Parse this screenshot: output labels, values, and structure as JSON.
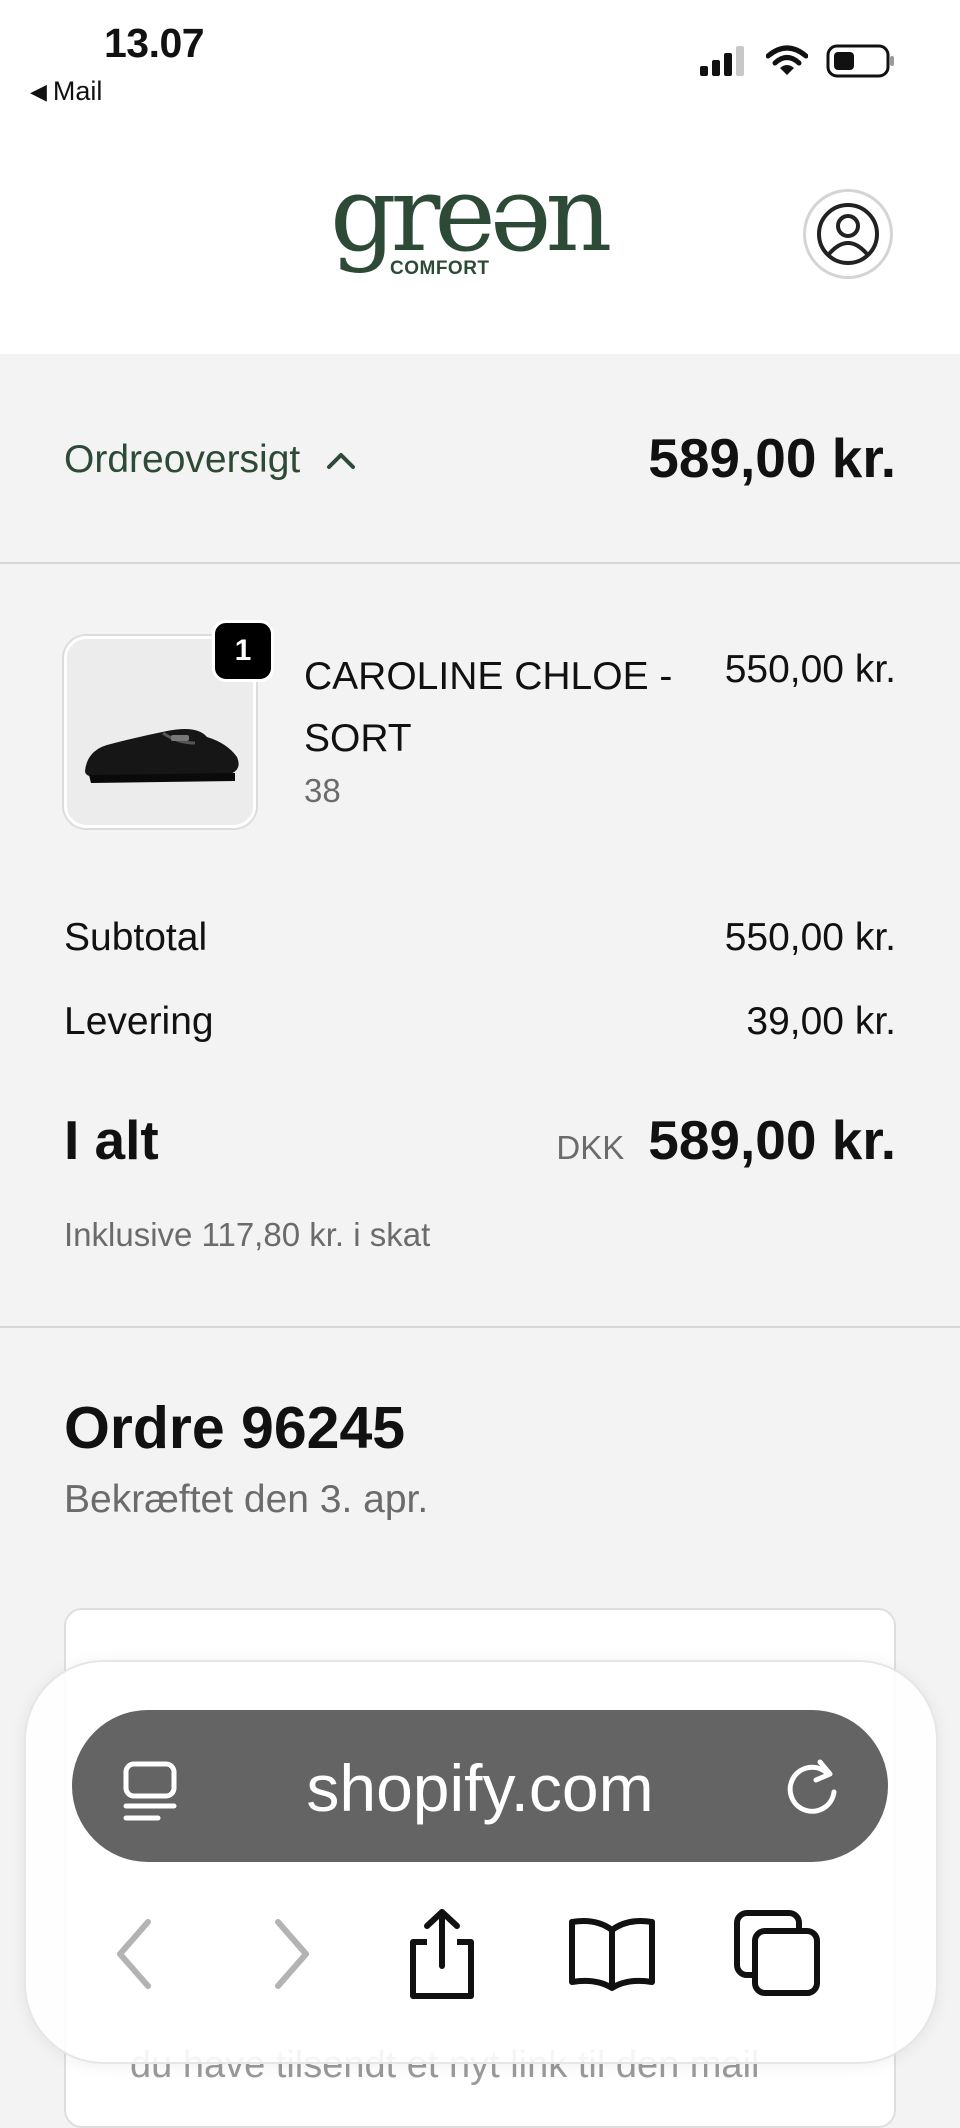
{
  "status_bar": {
    "time": "13.07",
    "back_label": "Mail",
    "icons": [
      "cellular-signal-icon",
      "wifi-icon",
      "battery-icon"
    ]
  },
  "header": {
    "logo_main": "greən",
    "logo_sub": "COMFORT",
    "logo_reg": "®",
    "account_icon": "user-circle-icon"
  },
  "summary": {
    "label": "Ordreoversigt",
    "total": "589,00 kr.",
    "toggle_icon": "chevron-up-icon"
  },
  "line_item": {
    "quantity": "1",
    "name": "CAROLINE CHLOE - SORT",
    "size": "38",
    "price": "550,00 kr.",
    "image_icon": "black-loafer-shoe-image"
  },
  "totals": {
    "subtotal_label": "Subtotal",
    "subtotal_value": "550,00 kr.",
    "shipping_label": "Levering",
    "shipping_value": "39,00 kr.",
    "total_label": "I alt",
    "currency": "DKK",
    "total_value": "589,00 kr.",
    "tax_note": "Inklusive 117,80 kr. i skat"
  },
  "order": {
    "title": "Ordre 96245",
    "subtitle": "Bekræftet den 3. apr."
  },
  "behind_toolbar_text": "du have tilsendt et nyt link til den mail",
  "browser": {
    "url": "shopify.com",
    "icons": [
      "reader-mode-icon",
      "reload-icon",
      "back-arrow-icon",
      "forward-arrow-icon",
      "share-icon",
      "bookmarks-icon",
      "tabs-icon"
    ]
  },
  "colors": {
    "brand_green": "#2d4a37",
    "background": "#f3f3f3",
    "url_pill": "#646464"
  }
}
